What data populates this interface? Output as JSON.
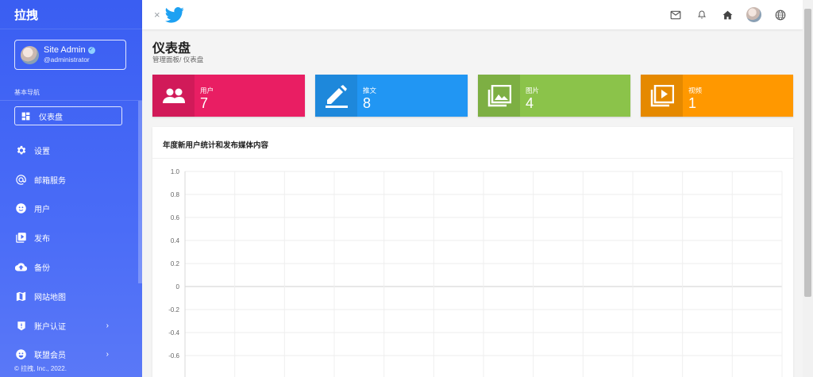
{
  "sidebar": {
    "brand": "拉拽",
    "user": {
      "name": "Site Admin",
      "handle": "@administrator"
    },
    "section_label": "基本导航",
    "items": [
      {
        "label": "仪表盘",
        "icon": "dashboard-icon",
        "active": true
      },
      {
        "label": "设置",
        "icon": "gear-icon"
      },
      {
        "label": "邮箱服务",
        "icon": "at-sign-icon"
      },
      {
        "label": "用户",
        "icon": "user-face-icon"
      },
      {
        "label": "发布",
        "icon": "video-library-icon"
      },
      {
        "label": "备份",
        "icon": "cloud-upload-icon"
      },
      {
        "label": "网站地图",
        "icon": "map-icon"
      },
      {
        "label": "账户认证",
        "icon": "alert-shield-icon",
        "has_children": true
      },
      {
        "label": "联盟会员",
        "icon": "emoji-icon",
        "has_children": true
      }
    ],
    "footer": "© 拉拽, Inc., 2022."
  },
  "topbar": {
    "close_symbol": "×",
    "icons": [
      "mail-icon",
      "bell-icon",
      "home-icon",
      "avatar",
      "globe-icon"
    ]
  },
  "page": {
    "title": "仪表盘",
    "breadcrumb": "管理面板/ 仪表盘"
  },
  "cards": [
    {
      "label": "用户",
      "value": "7",
      "color": "#e91e63",
      "icon_bg": "#d11a59",
      "icon": "people-icon"
    },
    {
      "label": "推文",
      "value": "8",
      "color": "#2196f3",
      "icon_bg": "#1e88db",
      "icon": "pencil-icon"
    },
    {
      "label": "图片",
      "value": "4",
      "color": "#8bc34a",
      "icon_bg": "#7daf43",
      "icon": "image-icon"
    },
    {
      "label": "视频",
      "value": "1",
      "color": "#ff9800",
      "icon_bg": "#e58900",
      "icon": "video-icon"
    }
  ],
  "panel": {
    "title": "年度新用户统计和发布媒体内容"
  },
  "chart_data": {
    "type": "line",
    "title": "",
    "xlabel": "",
    "ylabel": "",
    "ylim": [
      -0.8,
      1.0
    ],
    "y_ticks": [
      "1.0",
      "0.8",
      "0.6",
      "0.4",
      "0.2",
      "0",
      "-0.2",
      "-0.4",
      "-0.6"
    ],
    "x_grid_count": 12,
    "grid": true,
    "series": []
  },
  "colors": {
    "sidebar": "#4a6cf7",
    "twitter": "#1da1f2"
  }
}
